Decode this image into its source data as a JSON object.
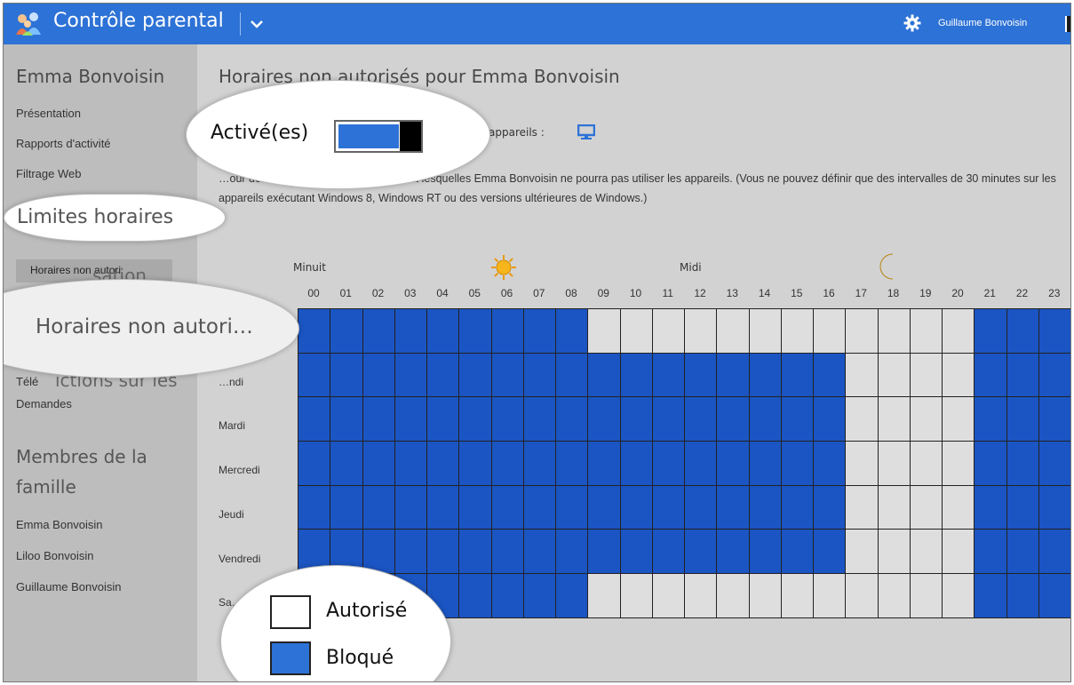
{
  "header": {
    "app_title": "Contrôle parental",
    "user_name": "Guillaume Bonvoisin",
    "icons": [
      "family-icon",
      "chevron-down-icon",
      "gear-icon"
    ]
  },
  "sidebar": {
    "user": "Emma Bonvoisin",
    "items": [
      {
        "label": "Présentation"
      },
      {
        "label": "Rapports d'activité"
      },
      {
        "label": "Filtrage Web"
      }
    ],
    "subitem_selected": "Horaires non autori",
    "ghost_heading": "Limites horaires",
    "ghost_restrictions": "Restrictions sur les",
    "ghost_other": "Restrictions sur l'utilisation",
    "item_tel": "Télé",
    "item_requests": "Demandes",
    "members_heading": "Membres de la famille",
    "members": [
      "Emma Bonvoisin",
      "Liloo Bonvoisin",
      "Guillaume Bonvoisin"
    ]
  },
  "main": {
    "title": "Horaires non autorisés pour Emma Bonvoisin",
    "devices_label": "appareils :",
    "description": "…our définir les plages horaires pendant lesquelles Emma Bonvoisin ne pourra pas utiliser les appareils. (Vous ne pouvez définir que des intervalles de 30 minutes sur les appareils exécutant Windows 8, Windows RT ou des versions ultérieures de Windows.)",
    "label_midnight": "Minuit",
    "label_noon": "Midi",
    "hours": [
      "00",
      "01",
      "02",
      "03",
      "04",
      "05",
      "06",
      "07",
      "08",
      "09",
      "10",
      "11",
      "12",
      "13",
      "14",
      "15",
      "16",
      "17",
      "18",
      "19",
      "20",
      "21",
      "22",
      "23"
    ],
    "days": [
      "",
      "…ndi",
      "Mardi",
      "Mercredi",
      "Jeudi",
      "Vendredi",
      "Sa…"
    ],
    "schedule_blocked_ranges": [
      {
        "day_index": 0,
        "blocked": [
          [
            0,
            8
          ],
          [
            21,
            23
          ]
        ]
      },
      {
        "day_index": 1,
        "blocked": [
          [
            0,
            16
          ],
          [
            21,
            23
          ]
        ]
      },
      {
        "day_index": 2,
        "blocked": [
          [
            0,
            16
          ],
          [
            21,
            23
          ]
        ]
      },
      {
        "day_index": 3,
        "blocked": [
          [
            0,
            16
          ],
          [
            21,
            23
          ]
        ]
      },
      {
        "day_index": 4,
        "blocked": [
          [
            0,
            16
          ],
          [
            21,
            23
          ]
        ]
      },
      {
        "day_index": 5,
        "blocked": [
          [
            0,
            16
          ],
          [
            21,
            23
          ]
        ]
      },
      {
        "day_index": 6,
        "blocked": [
          [
            0,
            8
          ],
          [
            21,
            23
          ]
        ]
      }
    ],
    "colors": {
      "blocked": "#1b55c3",
      "allowed": "#dedede",
      "accent": "#2d72d6"
    }
  },
  "callouts": {
    "toggle_label": "Activé(es)",
    "toggle_state": "on",
    "limits_label": "Limites horaires",
    "subpage_label": "Horaires non autori…",
    "legend_allowed": "Autorisé",
    "legend_blocked": "Bloqué"
  }
}
